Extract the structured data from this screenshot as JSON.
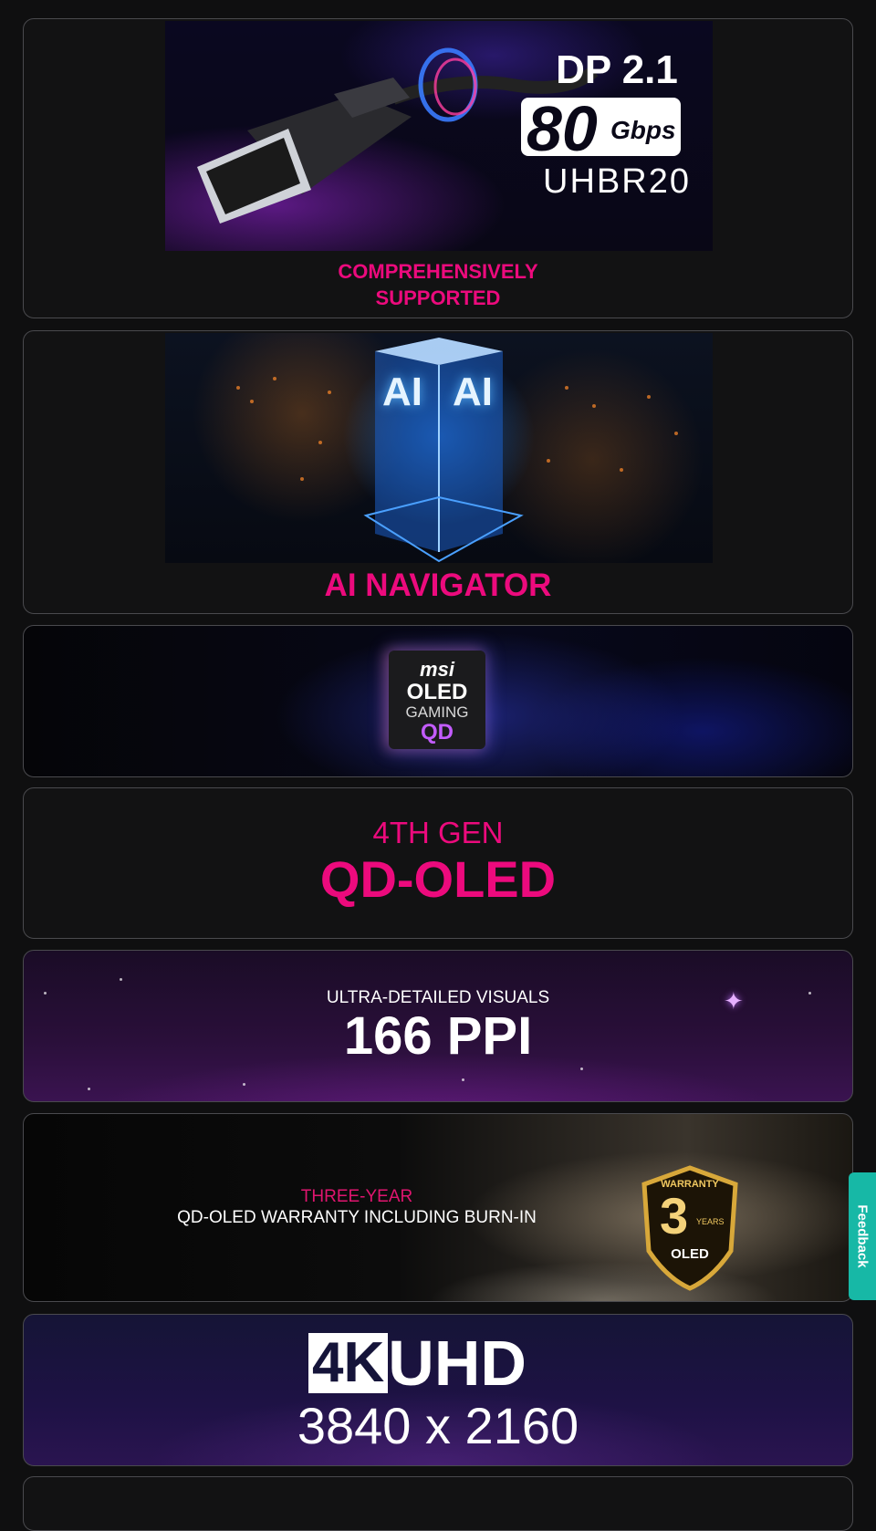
{
  "cards": {
    "dp": {
      "label_line1": "COMPREHENSIVELY",
      "label_line2": "SUPPORTED",
      "banner_dp": "DP 2.1",
      "banner_speed": "80",
      "banner_unit": "Gbps",
      "banner_uhbr": "UHBR20"
    },
    "ai": {
      "label": "AI NAVIGATOR",
      "chip_text": "AI"
    },
    "oled_badge": {
      "brand": "msi",
      "line1": "OLED",
      "line2": "GAMING",
      "line3": "QD"
    },
    "qd_oled": {
      "line1": "4TH GEN",
      "line2": "QD-OLED"
    },
    "ppi": {
      "line1": "ULTRA-DETAILED VISUALS",
      "line2": "166 PPI"
    },
    "warranty": {
      "line1": "THREE-YEAR",
      "line2": "QD-OLED WARRANTY INCLUDING BURN-IN",
      "shield_top": "WARRANTY",
      "shield_num": "3",
      "shield_years": "YEARS",
      "shield_bottom": "OLED"
    },
    "uhd": {
      "line1_a": "4K",
      "line1_b": "UHD",
      "line2": "3840 x 2160"
    }
  },
  "feedback": {
    "label": "Feedback"
  },
  "colors": {
    "accent": "#ec0a7d",
    "feedback": "#17b8a6",
    "background": "#0f0f10"
  }
}
